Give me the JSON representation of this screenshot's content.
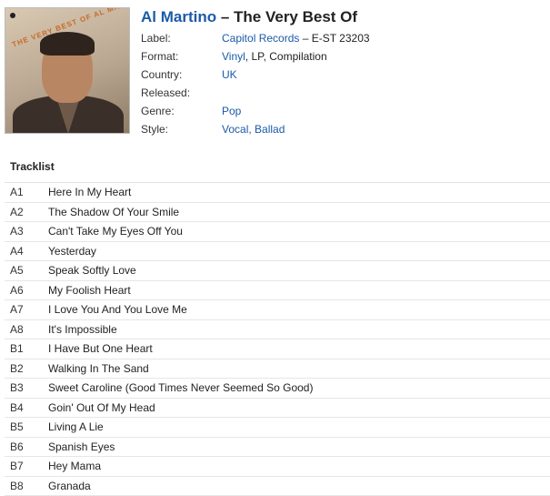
{
  "release": {
    "artist": "Al Martino",
    "separator": " – ",
    "title": "The Very Best Of",
    "cover_text": "THE VERY BEST OF AL MARTINO"
  },
  "info": [
    {
      "label": "Label:",
      "parts": [
        {
          "text": "Capitol Records",
          "link": true
        },
        {
          "text": " – E-ST 23203",
          "link": false
        }
      ]
    },
    {
      "label": "Format:",
      "parts": [
        {
          "text": "Vinyl",
          "link": true
        },
        {
          "text": ", LP, Compilation",
          "link": false
        }
      ]
    },
    {
      "label": "Country:",
      "parts": [
        {
          "text": "UK",
          "link": true
        }
      ]
    },
    {
      "label": "Released:",
      "parts": []
    },
    {
      "label": "Genre:",
      "parts": [
        {
          "text": "Pop",
          "link": true
        }
      ]
    },
    {
      "label": "Style:",
      "parts": [
        {
          "text": "Vocal, Ballad",
          "link": true
        }
      ]
    }
  ],
  "tracklist": {
    "heading": "Tracklist",
    "tracks": [
      {
        "pos": "A1",
        "title": "Here In My Heart"
      },
      {
        "pos": "A2",
        "title": "The Shadow Of Your Smile"
      },
      {
        "pos": "A3",
        "title": "Can't Take My Eyes Off You"
      },
      {
        "pos": "A4",
        "title": "Yesterday"
      },
      {
        "pos": "A5",
        "title": "Speak Softly Love"
      },
      {
        "pos": "A6",
        "title": "My Foolish Heart"
      },
      {
        "pos": "A7",
        "title": "I Love You And You Love Me"
      },
      {
        "pos": "A8",
        "title": "It's Impossible"
      },
      {
        "pos": "B1",
        "title": "I Have But One Heart"
      },
      {
        "pos": "B2",
        "title": "Walking In The Sand"
      },
      {
        "pos": "B3",
        "title": "Sweet Caroline (Good Times Never Seemed So Good)"
      },
      {
        "pos": "B4",
        "title": "Goin' Out Of My Head"
      },
      {
        "pos": "B5",
        "title": "Living A Lie"
      },
      {
        "pos": "B6",
        "title": "Spanish Eyes"
      },
      {
        "pos": "B7",
        "title": "Hey Mama"
      },
      {
        "pos": "B8",
        "title": "Granada"
      }
    ]
  },
  "colors": {
    "link": "#1b5aa8",
    "text": "#222222",
    "divider": "#e6e6e6"
  }
}
